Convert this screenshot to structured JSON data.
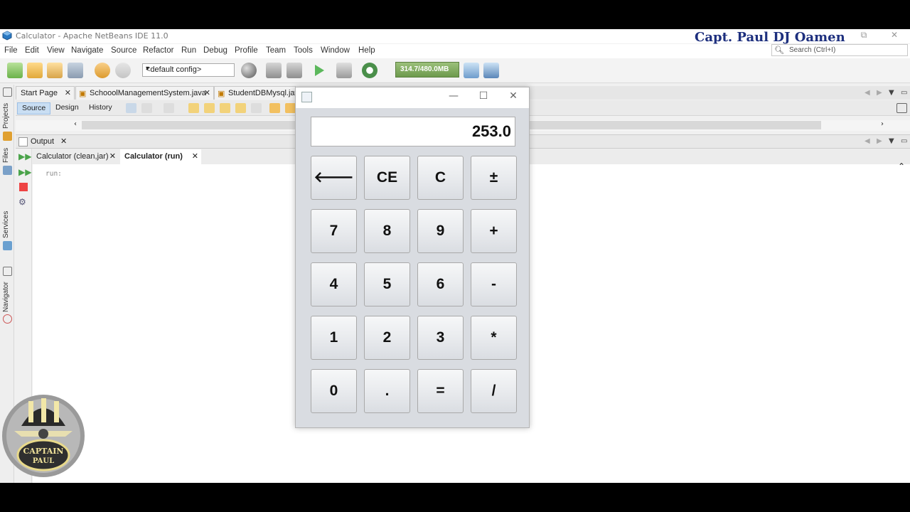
{
  "window": {
    "title": "Calculator - Apache NetBeans IDE 11.0",
    "brand": "Capt. Paul DJ Oamen",
    "controls": [
      "⧉",
      "✕"
    ]
  },
  "menu": [
    "File",
    "Edit",
    "View",
    "Navigate",
    "Source",
    "Refactor",
    "Run",
    "Debug",
    "Profile",
    "Team",
    "Tools",
    "Window",
    "Help"
  ],
  "search": {
    "placeholder": "Search (Ctrl+I)"
  },
  "toolbar": {
    "config": "<default config>",
    "memory": "314.7/480.0MB"
  },
  "leftrail": [
    "Projects",
    "Files",
    "Services",
    "Navigator"
  ],
  "editor_tabs": [
    {
      "label": "Start Page",
      "close": "✕"
    },
    {
      "label": "SchooolManagementSystem.java",
      "close": "✕"
    },
    {
      "label": "StudentDBMysql.java",
      "close": ""
    }
  ],
  "source_bar": {
    "source": "Source",
    "design": "Design",
    "history": "History"
  },
  "output": {
    "title": "Output",
    "close": "✕",
    "tabs": [
      {
        "label": "Calculator (clean,jar)",
        "close": "✕"
      },
      {
        "label": "Calculator (run)",
        "close": "✕"
      }
    ],
    "console": "run:"
  },
  "calculator": {
    "display": "253.0",
    "buttons": [
      [
        "🡐",
        "CE",
        "C",
        "±"
      ],
      [
        "7",
        "8",
        "9",
        "+"
      ],
      [
        "4",
        "5",
        "6",
        "-"
      ],
      [
        "1",
        "2",
        "3",
        "*"
      ],
      [
        "0",
        ".",
        "=",
        "/"
      ]
    ],
    "controls": [
      "—",
      "☐",
      "✕"
    ]
  },
  "logo": {
    "text_line1": "CAPTAIN",
    "text_line2": "PAUL"
  },
  "colors": {
    "brand": "#1d2f7e",
    "memory_bar": "#7aa65a",
    "active_tab": "#c9def3"
  }
}
